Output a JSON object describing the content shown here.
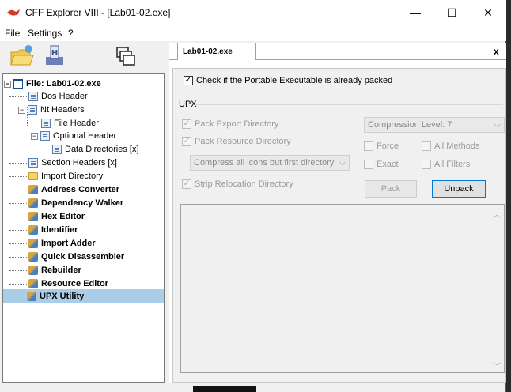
{
  "window": {
    "title": "CFF Explorer VIII - [Lab01-02.exe]",
    "min": "—",
    "max": "☐",
    "close": "✕"
  },
  "menu": [
    "File",
    "Settings",
    "?"
  ],
  "toolbar": [
    "open-folder-icon",
    "hex-save-icon",
    "windows-icon"
  ],
  "tree": {
    "root": "File: Lab01-02.exe",
    "items": {
      "dos_header": "Dos Header",
      "nt_headers": "Nt Headers",
      "file_header": "File Header",
      "optional_header": "Optional Header",
      "data_directories": "Data Directories [x]",
      "section_headers": "Section Headers [x]",
      "import_directory": "Import Directory",
      "address_converter": "Address Converter",
      "dependency_walker": "Dependency Walker",
      "hex_editor": "Hex Editor",
      "identifier": "Identifier",
      "import_adder": "Import Adder",
      "quick_disassembler": "Quick Disassembler",
      "rebuilder": "Rebuilder",
      "resource_editor": "Resource Editor",
      "upx_utility": "UPX Utility"
    },
    "expander_minus": "−"
  },
  "tab": {
    "label": "Lab01-02.exe",
    "close": "x"
  },
  "upx": {
    "packed_check_label": "Check if the Portable Executable is already packed",
    "packed_checked": true,
    "group_label": "UPX",
    "pack_export": "Pack Export Directory",
    "pack_resource": "Pack Resource Directory",
    "compress_combo": "Compress all icons but first directory",
    "strip_reloc": "Strip Relocation Directory",
    "compression_level": "Compression Level: 7",
    "force": "Force",
    "all_methods": "All Methods",
    "exact": "Exact",
    "all_filters": "All Filters",
    "pack_button": "Pack",
    "unpack_button": "Unpack",
    "check_mark": "✓",
    "combo_arrow": "⌵",
    "scroll_up": "︿",
    "scroll_down": "﹀"
  }
}
